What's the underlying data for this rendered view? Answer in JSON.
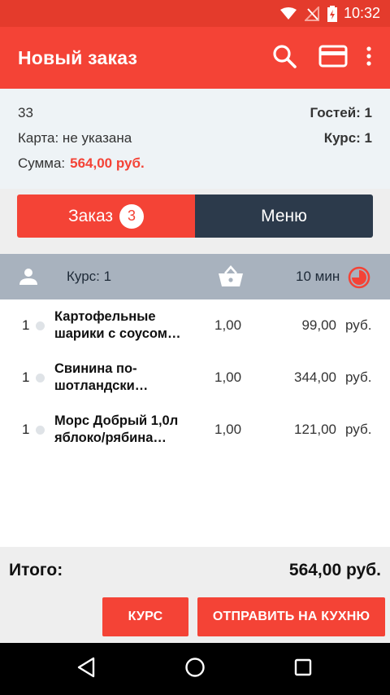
{
  "status_bar": {
    "time": "10:32",
    "icons": [
      "wifi-icon",
      "no-signal-icon",
      "battery-icon"
    ]
  },
  "app_bar": {
    "title": "Новый заказ",
    "actions": [
      "search-icon",
      "card-icon",
      "more-vert-icon"
    ]
  },
  "order_info": {
    "table": "33",
    "guests": "Гостей: 1",
    "card": "Карта: не указана",
    "course": "Курс: 1",
    "sum_label": "Сумма:",
    "sum_value": "564,00  руб."
  },
  "tabs": {
    "order_label": "Заказ",
    "order_count": "3",
    "menu_label": "Меню"
  },
  "course_bar": {
    "label": "Курс: 1",
    "time": "10 мин"
  },
  "items": [
    {
      "qty": "1",
      "name_line1": "Картофельные",
      "name_line2": "шарики с соусом…",
      "amount": "1,00",
      "price": "99,00",
      "currency": "руб."
    },
    {
      "qty": "1",
      "name_line1": "Свинина по-",
      "name_line2": "шотландски…",
      "amount": "1,00",
      "price": "344,00",
      "currency": "руб."
    },
    {
      "qty": "1",
      "name_line1": "Морс  Добрый 1,0л",
      "name_line2": "яблоко/рябина…",
      "amount": "1,00",
      "price": "121,00",
      "currency": "руб."
    }
  ],
  "footer": {
    "total_label": "Итого:",
    "total_value": "564,00  руб.",
    "course_button": "КУРС",
    "kitchen_button": "ОТПРАВИТЬ НА КУХНЮ"
  },
  "colors": {
    "accent": "#f44336",
    "status_bar": "#e43b2c",
    "dark_tab": "#2c3a4b",
    "course_bar": "#a8b2be"
  }
}
